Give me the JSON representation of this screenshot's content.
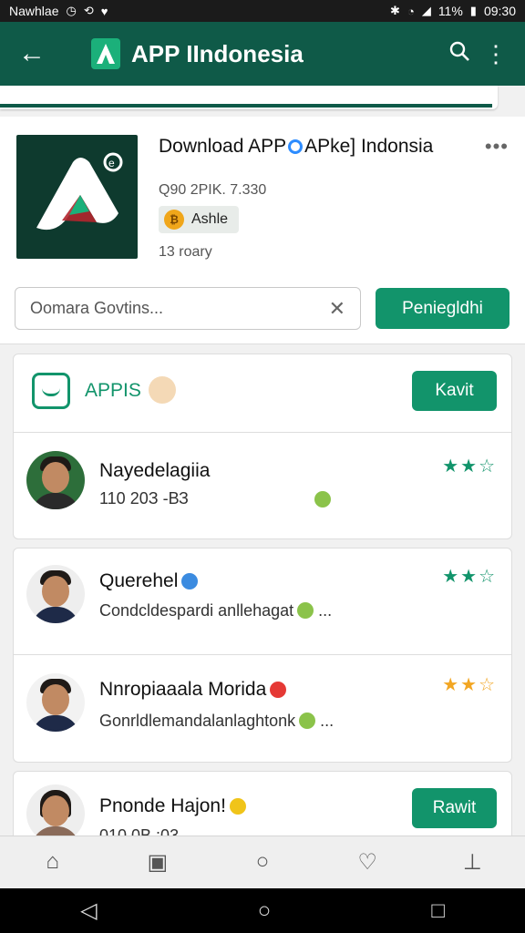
{
  "status_bar": {
    "left_text": "Nawhlae",
    "battery": "11%",
    "time": "09:30"
  },
  "app_bar": {
    "title": "APP IIndonesia"
  },
  "app": {
    "name_part1": "Download APP",
    "name_part2": "APke] Indonsia",
    "version": "Q90 2PIK. 7.330",
    "chip": "Ashle",
    "meta": "13 roary"
  },
  "search": {
    "placeholder": "Oomara Govtins...",
    "action": "Peniegldhi"
  },
  "reviews_header": {
    "title": "APPIS",
    "button": "Kavit"
  },
  "reviews": [
    {
      "name": "Nayedelagiia",
      "text": "110 20З -ВЗ",
      "stars": "★★☆"
    },
    {
      "name": "Querehel",
      "text": "Condcldespardi anllehagat",
      "stars": "★★☆"
    },
    {
      "name": "Nnropiaaala Morida",
      "text": "Gonrldlemandalanlaghtonk",
      "stars": "★★☆"
    },
    {
      "name": "Pnonde Hajon!",
      "text": "010 0В :03",
      "button": "Rawit"
    }
  ],
  "colors": {
    "brand": "#0f5a48",
    "accent": "#12946b",
    "star_green": "#12946b",
    "star_orange": "#f2a623"
  }
}
